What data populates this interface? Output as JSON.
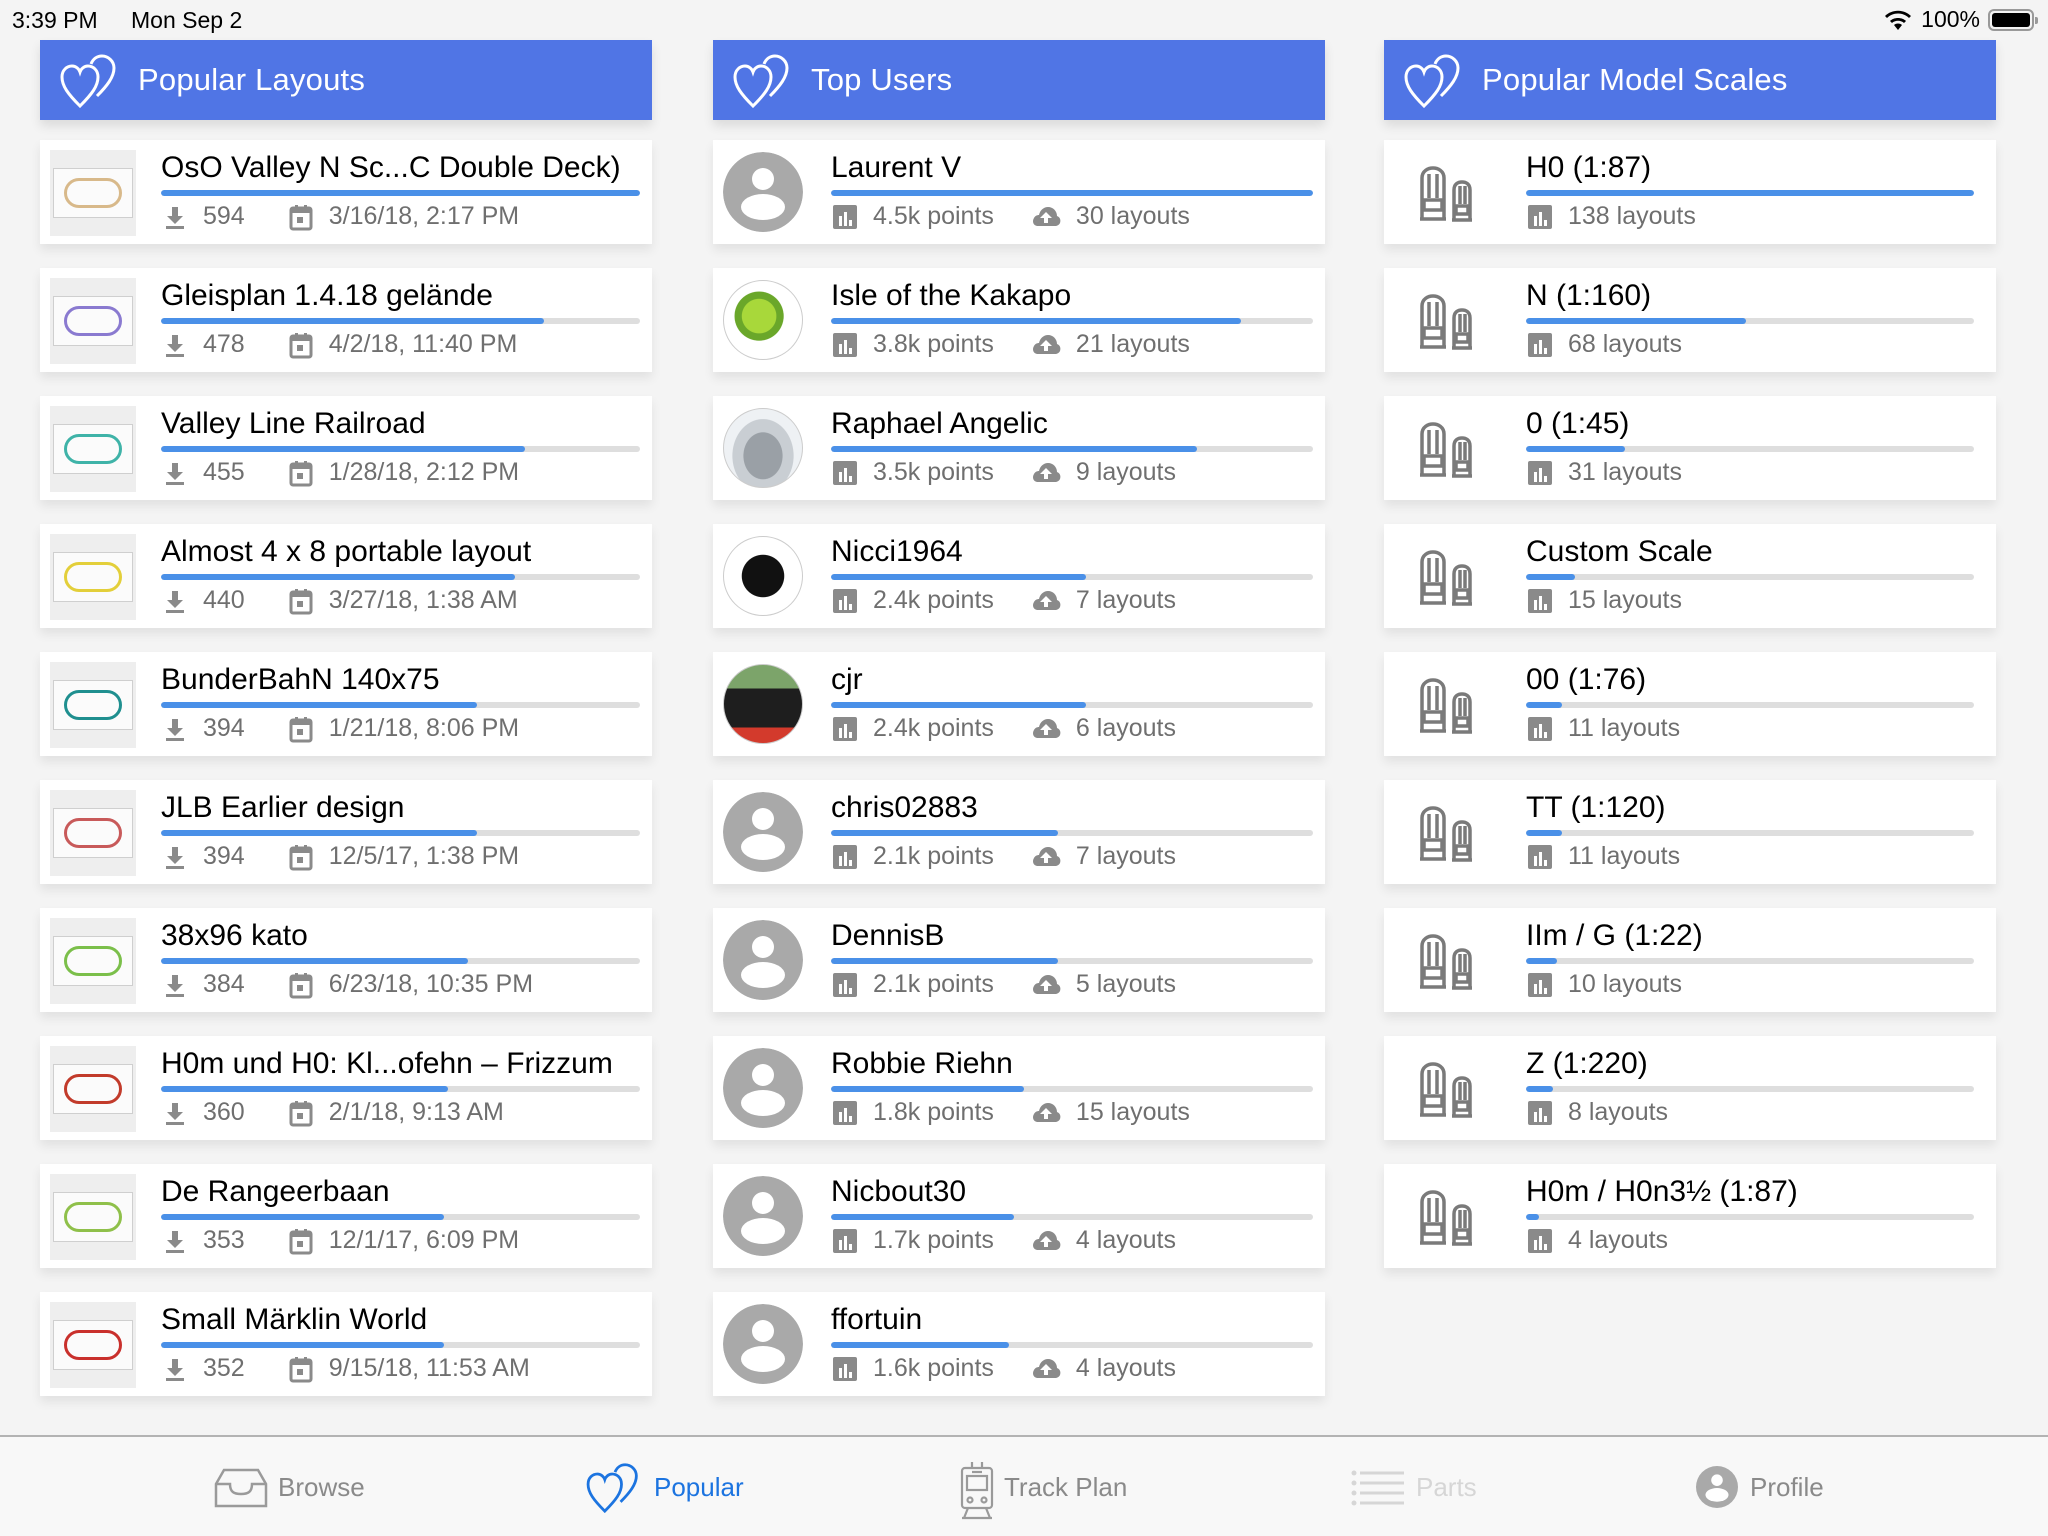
{
  "status_bar": {
    "time": "3:39 PM",
    "date": "Mon Sep 2",
    "battery": "100%",
    "battery_level": 1.0
  },
  "colors": {
    "header_bg": "#5075e5",
    "progress_fill": "#4a90e8",
    "progress_track": "#dedede",
    "tab_active": "#1c74e0",
    "tab_inactive": "#8a8a8a",
    "tab_disabled": "#d6d6d6"
  },
  "popular_layouts": {
    "title": "Popular Layouts",
    "icon": "hearts-icon",
    "items": [
      {
        "name": "OsO Valley N Sc...C Double Deck)",
        "downloads": "594",
        "date": "3/16/18, 2:17 PM",
        "progress": 1.0,
        "thumb_color": "#d8b98a"
      },
      {
        "name": "Gleisplan 1.4.18 gelände",
        "downloads": "478",
        "date": "4/2/18, 11:40 PM",
        "progress": 0.8,
        "thumb_color": "#8a7ad0"
      },
      {
        "name": "Valley Line Railroad",
        "downloads": "455",
        "date": "1/28/18, 2:12 PM",
        "progress": 0.76,
        "thumb_color": "#3fb3a8"
      },
      {
        "name": "Almost 4 x 8 portable layout",
        "downloads": "440",
        "date": "3/27/18, 1:38 AM",
        "progress": 0.74,
        "thumb_color": "#e3cf3a"
      },
      {
        "name": "BunderBahN 140x75",
        "downloads": "394",
        "date": "1/21/18, 8:06 PM",
        "progress": 0.66,
        "thumb_color": "#1f8f8f"
      },
      {
        "name": "JLB Earlier design",
        "downloads": "394",
        "date": "12/5/17, 1:38 PM",
        "progress": 0.66,
        "thumb_color": "#c85a5a"
      },
      {
        "name": "38x96 kato",
        "downloads": "384",
        "date": "6/23/18, 10:35 PM",
        "progress": 0.64,
        "thumb_color": "#7bbf4a"
      },
      {
        "name": "H0m und H0: Kl...ofehn – Frizzum",
        "downloads": "360",
        "date": "2/1/18, 9:13 AM",
        "progress": 0.6,
        "thumb_color": "#c23b2b"
      },
      {
        "name": "De Rangeerbaan",
        "downloads": "353",
        "date": "12/1/17, 6:09 PM",
        "progress": 0.59,
        "thumb_color": "#8fc04a"
      },
      {
        "name": "Small Märklin World",
        "downloads": "352",
        "date": "9/15/18, 11:53 AM",
        "progress": 0.59,
        "thumb_color": "#c9302c"
      }
    ]
  },
  "top_users": {
    "title": "Top Users",
    "icon": "hearts-icon",
    "items": [
      {
        "name": "Laurent V",
        "points": "4.5k points",
        "layouts": "30 layouts",
        "progress": 1.0,
        "avatar": "default"
      },
      {
        "name": "Isle of the Kakapo",
        "points": "3.8k points",
        "layouts": "21 layouts",
        "progress": 0.85,
        "avatar": "parrot"
      },
      {
        "name": "Raphael Angelic",
        "points": "3.5k points",
        "layouts": "9 layouts",
        "progress": 0.76,
        "avatar": "penguin"
      },
      {
        "name": "Nicci1964",
        "points": "2.4k points",
        "layouts": "7 layouts",
        "progress": 0.53,
        "avatar": "locomotive-sketch"
      },
      {
        "name": "cjr",
        "points": "2.4k points",
        "layouts": "6 layouts",
        "progress": 0.53,
        "avatar": "locomotive-photo"
      },
      {
        "name": "chris02883",
        "points": "2.1k points",
        "layouts": "7 layouts",
        "progress": 0.47,
        "avatar": "default"
      },
      {
        "name": "DennisB",
        "points": "2.1k points",
        "layouts": "5 layouts",
        "progress": 0.47,
        "avatar": "default"
      },
      {
        "name": "Robbie Riehn",
        "points": "1.8k points",
        "layouts": "15 layouts",
        "progress": 0.4,
        "avatar": "default"
      },
      {
        "name": "Nicbout30",
        "points": "1.7k points",
        "layouts": "4 layouts",
        "progress": 0.38,
        "avatar": "default"
      },
      {
        "name": "ffortuin",
        "points": "1.6k points",
        "layouts": "4 layouts",
        "progress": 0.37,
        "avatar": "default"
      }
    ]
  },
  "popular_scales": {
    "title": "Popular Model Scales",
    "icon": "hearts-icon",
    "items": [
      {
        "name": "H0 (1:87)",
        "layouts": "138 layouts",
        "progress": 1.0
      },
      {
        "name": "N (1:160)",
        "layouts": "68 layouts",
        "progress": 0.49
      },
      {
        "name": "0 (1:45)",
        "layouts": "31 layouts",
        "progress": 0.22
      },
      {
        "name": "Custom Scale",
        "layouts": "15 layouts",
        "progress": 0.11
      },
      {
        "name": "00 (1:76)",
        "layouts": "11 layouts",
        "progress": 0.08
      },
      {
        "name": "TT (1:120)",
        "layouts": "11 layouts",
        "progress": 0.08
      },
      {
        "name": "IIm / G (1:22)",
        "layouts": "10 layouts",
        "progress": 0.07
      },
      {
        "name": "Z (1:220)",
        "layouts": "8 layouts",
        "progress": 0.06
      },
      {
        "name": "H0m / H0n3½ (1:87)",
        "layouts": "4 layouts",
        "progress": 0.03
      }
    ]
  },
  "tab_bar": {
    "active": "popular",
    "tabs": [
      {
        "id": "browse",
        "label": "Browse",
        "icon": "inbox-tray-icon",
        "state": "inactive"
      },
      {
        "id": "popular",
        "label": "Popular",
        "icon": "hearts-icon",
        "state": "active"
      },
      {
        "id": "trackplan",
        "label": "Track Plan",
        "icon": "train-icon",
        "state": "inactive"
      },
      {
        "id": "parts",
        "label": "Parts",
        "icon": "list-icon",
        "state": "disabled"
      },
      {
        "id": "profile",
        "label": "Profile",
        "icon": "person-circle-icon",
        "state": "inactive"
      }
    ]
  }
}
